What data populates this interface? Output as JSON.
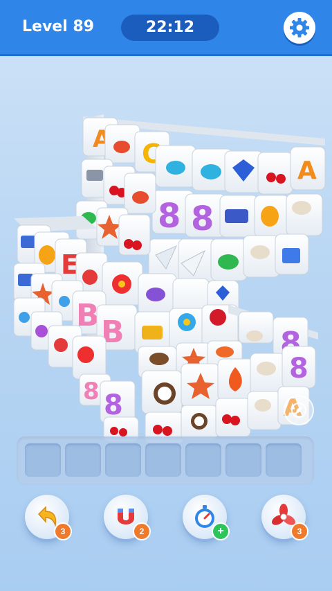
{
  "header": {
    "level_label": "Level 89",
    "timer": "22:12",
    "settings_icon": "gear-icon"
  },
  "colors": {
    "header_blue": "#2f86e8",
    "timer_bg": "#1a5dbd",
    "badge_orange": "#f07a2b",
    "badge_green": "#2ec45c"
  },
  "board": {
    "tile_icons": [
      "letter-a",
      "letter-b",
      "letter-c",
      "number-8",
      "teacup",
      "cherries",
      "diamond",
      "starfish",
      "flower",
      "orange",
      "mushroom",
      "gift-box",
      "truck",
      "paper-plane",
      "eggplant",
      "rose",
      "coconut",
      "flame",
      "leaf"
    ]
  },
  "tray": {
    "slot_count": 7
  },
  "powerups": [
    {
      "name": "undo",
      "icon": "undo-arrow-icon",
      "count": "3"
    },
    {
      "name": "magnet",
      "icon": "magnet-icon",
      "count": "2"
    },
    {
      "name": "freeze-timer",
      "icon": "stopwatch-icon",
      "count": "+"
    },
    {
      "name": "shuffle",
      "icon": "fan-icon",
      "count": "3"
    }
  ]
}
